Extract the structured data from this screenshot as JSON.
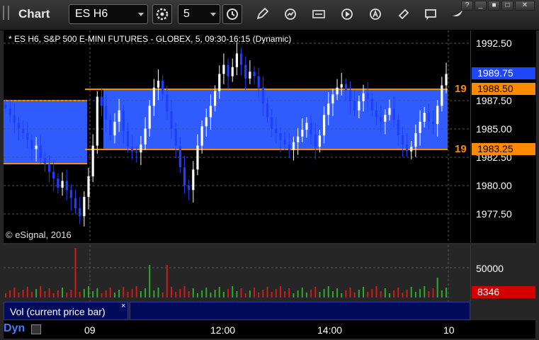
{
  "app": {
    "title": "Chart"
  },
  "toolbar": {
    "symbol": "ES H6",
    "interval": "5"
  },
  "chart": {
    "header": "* ES H6, S&P 500 E-MINI FUTURES - GLOBEX, 5, 09:30-16:15 (Dynamic)",
    "copyright": "© eSignal, 2016",
    "price_ticks": [
      "1992.50",
      "1987.50",
      "1985.00",
      "1982.50",
      "1980.00",
      "1977.50"
    ],
    "last_price": "1989.75",
    "upper_level": {
      "value": "1988.50",
      "label": "19"
    },
    "lower_level": {
      "value": "1983.25",
      "label": "19"
    },
    "colors": {
      "band": "#2f5bff",
      "level_line": "#ff8a00",
      "up_bar": "#ffffff",
      "down_bar": "#1f3fff",
      "last_price_tag": "#1e46ff",
      "volume_tag": "#d50000"
    }
  },
  "volume": {
    "tick": "50000",
    "current": "8346",
    "legend": "Vol (current price bar)",
    "close_glyph": "×"
  },
  "x_axis": {
    "labels": [
      "09",
      "12:00",
      "14:00",
      "10"
    ],
    "mode": "Dyn"
  },
  "chart_data": {
    "type": "candlestick",
    "title": "ES H6, S&P 500 E-MINI FUTURES - GLOBEX, 5, 09:30-16:15 (Dynamic)",
    "ylim": [
      1975.5,
      1994.5
    ],
    "yticks": [
      1977.5,
      1980.0,
      1982.5,
      1985.0,
      1987.5,
      1992.5
    ],
    "xticks": [
      "09",
      "12:00",
      "14:00",
      "10"
    ],
    "levels": [
      1988.5,
      1983.25
    ],
    "last": 1989.75,
    "volume_last": 8346
  }
}
